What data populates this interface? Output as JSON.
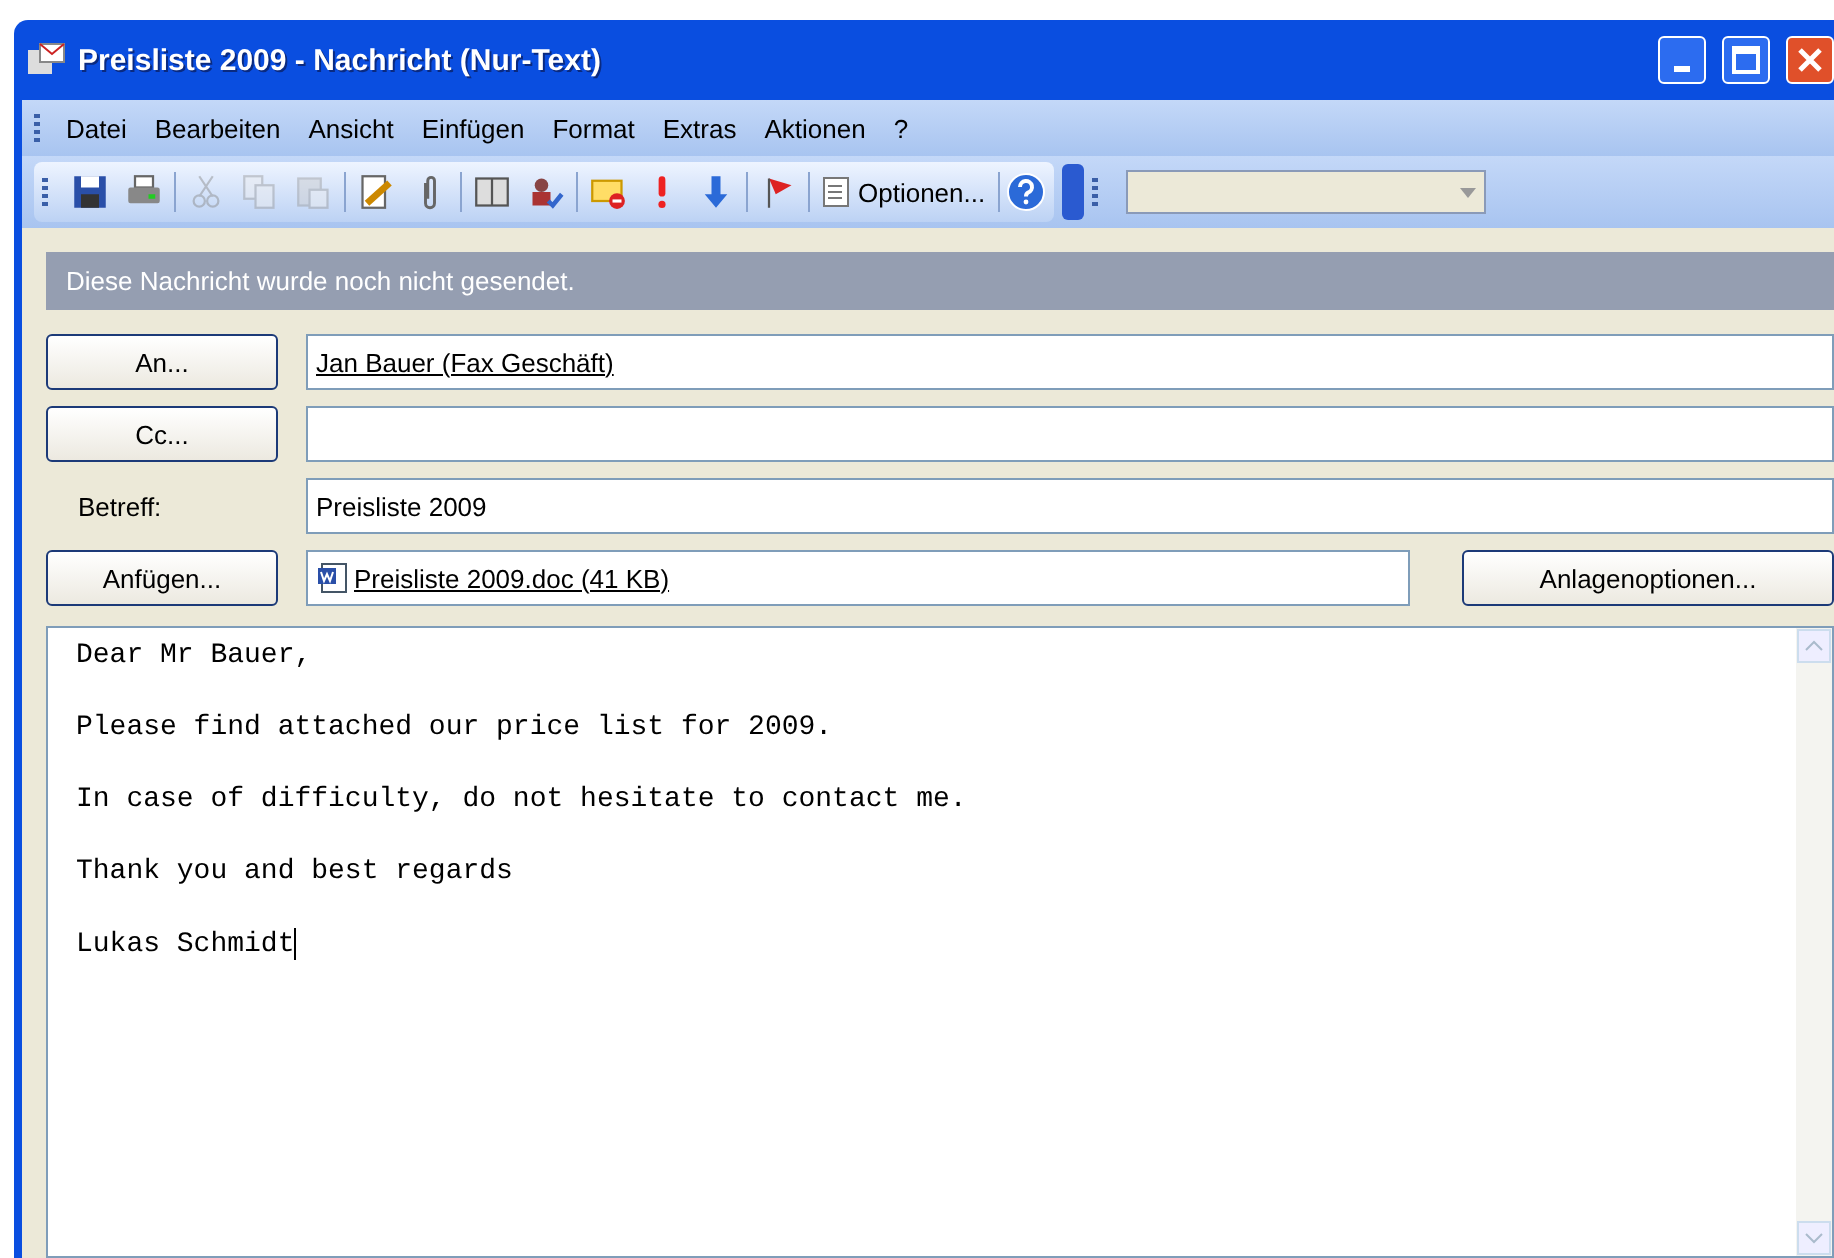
{
  "window": {
    "title": "Preisliste 2009 - Nachricht (Nur-Text)"
  },
  "menu": [
    "Datei",
    "Bearbeiten",
    "Ansicht",
    "Einfügen",
    "Format",
    "Extras",
    "Aktionen",
    "?"
  ],
  "toolbar": {
    "items": [
      {
        "disabled": false
      },
      {
        "disabled": false
      },
      {
        "disabled": true
      },
      {
        "disabled": true
      },
      {
        "disabled": true
      },
      {
        "disabled": false
      },
      {
        "disabled": false
      },
      {
        "disabled": false
      },
      {
        "disabled": false
      },
      {
        "disabled": false
      },
      {
        "disabled": false
      },
      {
        "disabled": false
      },
      {
        "disabled": false
      }
    ],
    "options_label": "Optionen..."
  },
  "info_bar": "Diese Nachricht wurde noch nicht gesendet.",
  "to": {
    "button": "An...",
    "value": "Jan Bauer (Fax Geschäft)"
  },
  "cc": {
    "button": "Cc..."
  },
  "subject": {
    "label": "Betreff:",
    "value": "Preisliste 2009"
  },
  "attach": {
    "button": "Anfügen...",
    "file": "Preisliste 2009.doc (41 KB)",
    "options_button": "Anlagenoptionen..."
  },
  "body": [
    "Dear Mr Bauer,",
    "Please find attached our price list for 2009.",
    "In case of difficulty, do not hesitate to contact me.",
    "Thank you and best regards",
    "Lukas Schmidt"
  ]
}
